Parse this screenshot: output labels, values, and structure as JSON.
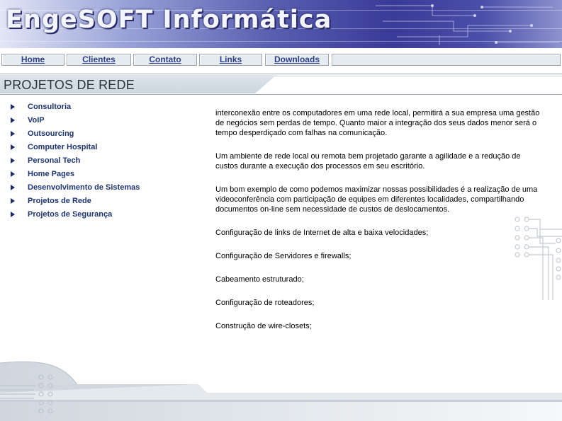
{
  "header": {
    "title": "EngeSOFT Informática",
    "colors": {
      "banner_dark": "#3a3a98",
      "banner_light": "#e2e6f6"
    }
  },
  "nav": {
    "items": [
      {
        "label": "Home"
      },
      {
        "label": "Clientes"
      },
      {
        "label": "Contato"
      },
      {
        "label": "Links"
      },
      {
        "label": "Downloads"
      }
    ]
  },
  "page": {
    "title": "PROJETOS DE REDE"
  },
  "sidebar": {
    "items": [
      {
        "label": "Consultoria"
      },
      {
        "label": "VoIP"
      },
      {
        "label": "Outsourcing"
      },
      {
        "label": "Computer Hospital"
      },
      {
        "label": "Personal Tech"
      },
      {
        "label": "Home Pages"
      },
      {
        "label": "Desenvolvimento de Sistemas"
      },
      {
        "label": "Projetos de Rede"
      },
      {
        "label": "Projetos de Segurança"
      }
    ]
  },
  "content": {
    "paragraphs": [
      "interconexão entre os computadores em uma rede local, permitirá a sua empresa uma gestão de negócios sem perdas de tempo. Quanto maior a integração dos seus dados menor será o tempo desperdiçado com falhas na comunicação.",
      "Um ambiente de rede local ou remota bem projetado garante a agilidade e a redução de custos durante a execução dos processos em seu escritório.",
      "Um bom exemplo de como podemos maximizar nossas possibilidades é a realização de uma videoconferência com participação de equipes em diferentes localidades, compartilhando documentos on-line sem necessidade de custos de deslocamentos."
    ],
    "features": [
      "Configuração de links de Internet de alta e baixa velocidades;",
      "Configuração de Servidores e firewalls;",
      "Cabeamento estruturado;",
      "Configuração de roteadores;",
      "Construção de wire-closets;"
    ]
  }
}
